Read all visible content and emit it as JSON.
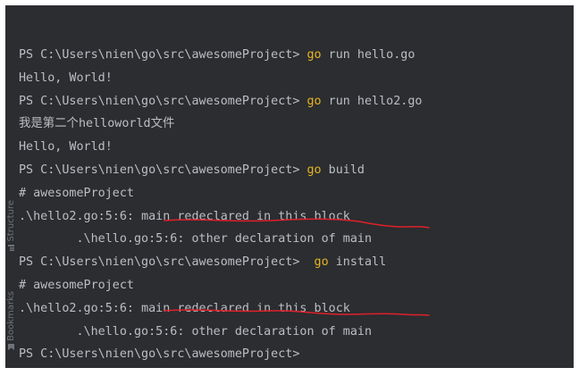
{
  "sidebar": {
    "structure_label": "Structure",
    "bookmarks_label": "Bookmarks"
  },
  "terminal": {
    "lines": [
      {
        "prefix": "PS C:\\Users\\nien\\go\\src\\awesomeProject> ",
        "keyword": "go",
        "suffix": " run hello.go"
      },
      {
        "text": "Hello, World!"
      },
      {
        "prefix": "PS C:\\Users\\nien\\go\\src\\awesomeProject> ",
        "keyword": "go",
        "suffix": " run hello2.go"
      },
      {
        "text": "我是第二个helloworld文件"
      },
      {
        "text": "Hello, World!"
      },
      {
        "prefix": "PS C:\\Users\\nien\\go\\src\\awesomeProject> ",
        "keyword": "go",
        "suffix": " build"
      },
      {
        "text": "# awesomeProject"
      },
      {
        "prefix": ".\\hello2.go:5:6: ",
        "error": "main redeclared in this block"
      },
      {
        "text": "        .\\hello.go:5:6: other declaration of main"
      },
      {
        "prefix": "PS C:\\Users\\nien\\go\\src\\awesomeProject>  ",
        "keyword": "go",
        "suffix": " install"
      },
      {
        "text": "# awesomeProject"
      },
      {
        "prefix": ".\\hello2.go:5:6: ",
        "error": "main redeclared in this block"
      },
      {
        "text": "        .\\hello.go:5:6: other declaration of main"
      },
      {
        "text": "PS C:\\Users\\nien\\go\\src\\awesomeProject>"
      }
    ]
  },
  "colors": {
    "background": "#2b2d30",
    "text": "#bcbec4",
    "keyword": "#e6b422",
    "annotation": "#e0202a"
  }
}
